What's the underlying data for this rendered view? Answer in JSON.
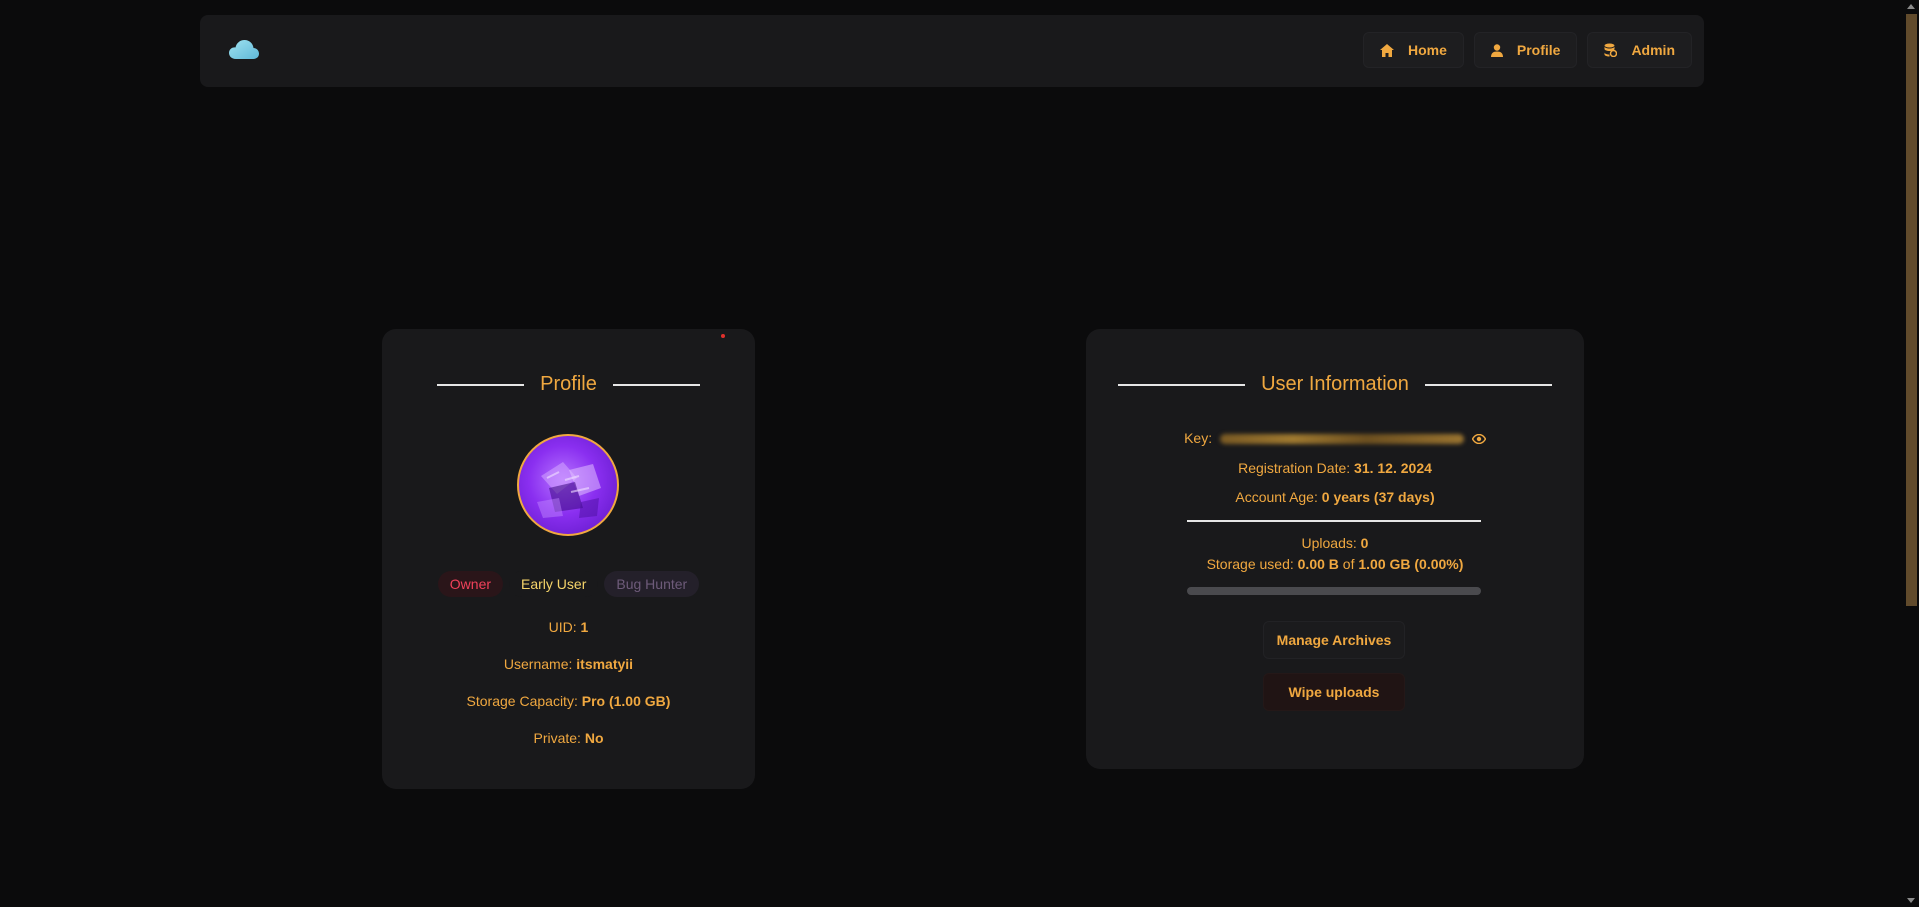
{
  "nav": {
    "logo_icon": "cloud-icon",
    "items": [
      {
        "label": "Home",
        "icon": "home-icon"
      },
      {
        "label": "Profile",
        "icon": "user-icon"
      },
      {
        "label": "Admin",
        "icon": "database-icon"
      }
    ]
  },
  "profile": {
    "title": "Profile",
    "badges": [
      "Owner",
      "Early User",
      "Bug Hunter"
    ],
    "uid_label": "UID:",
    "uid_value": "1",
    "username_label": "Username:",
    "username_value": "itsmatyii",
    "storage_label": "Storage Capacity:",
    "storage_value": "Pro (1.00 GB)",
    "private_label": "Private:",
    "private_value": "No"
  },
  "user_info": {
    "title": "User Information",
    "key_label": "Key:",
    "key_toggle_icon": "eye-icon",
    "registration_label": "Registration Date:",
    "registration_value": "31. 12. 2024",
    "account_age_label": "Account Age:",
    "account_age_value": "0 years (37 days)",
    "uploads_label": "Uploads:",
    "uploads_value": "0",
    "storage_used_label": "Storage used:",
    "storage_used_value": "0.00 B",
    "storage_of": "of",
    "storage_total": "1.00 GB",
    "storage_percent": "(0.00%)",
    "storage_fraction": 0,
    "manage_archives_label": "Manage Archives",
    "wipe_uploads_label": "Wipe uploads"
  },
  "colors": {
    "accent": "#f0a840",
    "background": "#0b0b0c",
    "card": "#19191b",
    "owner_badge": "#f0415a",
    "early_user_badge": "#f5d46a",
    "logo": "#7ad4e8"
  }
}
